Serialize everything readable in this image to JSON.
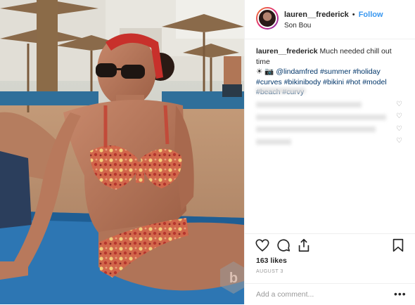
{
  "post": {
    "username": "lauren__frederick",
    "separator": "•",
    "follow_label": "Follow",
    "location": "Son Bou",
    "caption": {
      "username": "lauren__frederick",
      "text": "Much needed chill out time",
      "emojis": "☀ 📷",
      "mention": "@lindamfred",
      "hashtags": [
        "#summer",
        "#holiday",
        "#curves",
        "#bikinibody",
        "#bikini",
        "#hot",
        "#model",
        "#beach",
        "#curvy"
      ]
    },
    "likes": "163 likes",
    "date": "AUGUST 3",
    "comment_placeholder": "Add a comment...",
    "more_label": "•••"
  },
  "icons": [
    "heart-icon",
    "comment-icon",
    "share-icon",
    "bookmark-icon",
    "avatar-icon",
    "watermark-logo"
  ]
}
